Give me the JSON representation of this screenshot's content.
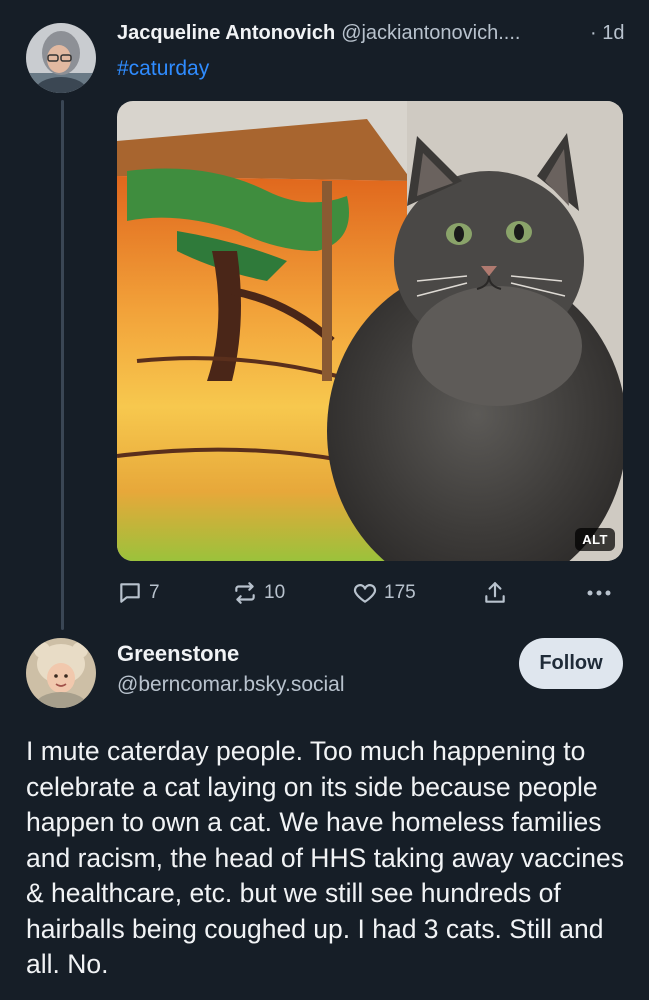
{
  "post": {
    "author_name": "Jacqueline Antonovich",
    "author_handle": "@jackiantonovich....",
    "time": "· 1d",
    "hashtag": "#caturday",
    "image_alt_badge": "ALT",
    "actions": {
      "replies": "7",
      "reposts": "10",
      "likes": "175"
    },
    "icons": [
      "reply-icon",
      "repost-icon",
      "like-icon",
      "share-icon",
      "more-icon"
    ]
  },
  "reply": {
    "author_name": "Greenstone",
    "author_handle": "@berncomar.bsky.social",
    "follow_label": "Follow",
    "text": "I mute caterday people. Too much happening to celebrate a cat laying on its side because people happen to own a cat. We have homeless families and racism, the head of HHS taking away vaccines & healthcare, etc. but we still see hundreds of hairballs being coughed up. I had 3 cats. Still and all. No."
  },
  "colors": {
    "background": "#161e27",
    "accent_link": "#2f8cff",
    "muted_text": "#b8c2cd",
    "follow_button_bg": "#dfe6ee"
  }
}
